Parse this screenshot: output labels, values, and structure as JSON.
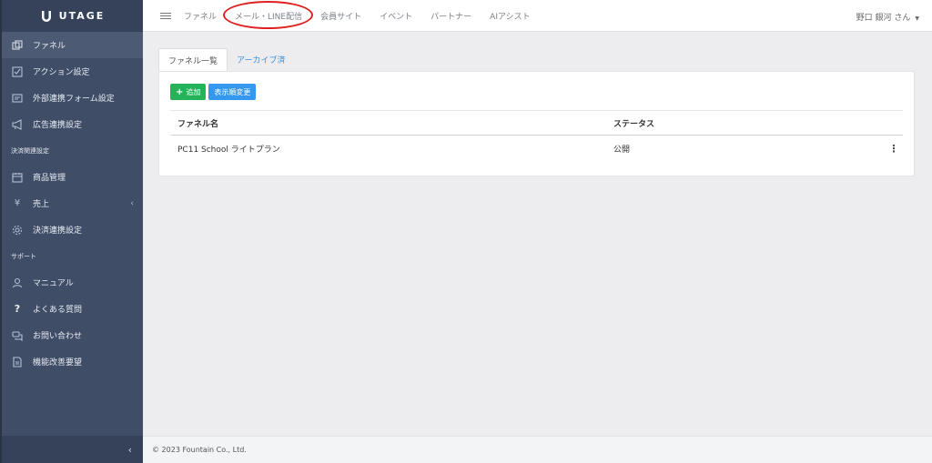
{
  "brand": {
    "name": "UTAGE"
  },
  "sidebar": {
    "items_main": [
      {
        "label": "ファネル",
        "icon": "copy-icon"
      },
      {
        "label": "アクション設定",
        "icon": "checklist-icon"
      },
      {
        "label": "外部連携フォーム設定",
        "icon": "form-icon"
      },
      {
        "label": "広告連携設定",
        "icon": "megaphone-icon"
      }
    ],
    "section_payment": "決済関連設定",
    "items_payment": [
      {
        "label": "商品管理",
        "icon": "calendar-icon"
      },
      {
        "label": "売上",
        "icon": "yen-icon"
      },
      {
        "label": "決済連携設定",
        "icon": "gear-icon"
      }
    ],
    "section_support": "サポート",
    "items_support": [
      {
        "label": "マニュアル",
        "icon": "person-icon"
      },
      {
        "label": "よくある質問",
        "icon": "question-icon"
      },
      {
        "label": "お問い合わせ",
        "icon": "chat-icon"
      },
      {
        "label": "機能改善要望",
        "icon": "document-icon"
      }
    ]
  },
  "topnav": {
    "items": [
      "ファネル",
      "メール・LINE配信",
      "会員サイト",
      "イベント",
      "パートナー",
      "AIアシスト"
    ],
    "user": "野口 銀河 さん"
  },
  "tabs": [
    "ファネル一覧",
    "アーカイブ済"
  ],
  "buttons": {
    "add": "追加",
    "reorder": "表示順変更"
  },
  "table": {
    "headers": [
      "ファネル名",
      "ステータス"
    ],
    "rows": [
      {
        "name": "PC11 School ライトプラン",
        "status": "公開"
      }
    ]
  },
  "footer": "© 2023 Fountain Co., Ltd."
}
